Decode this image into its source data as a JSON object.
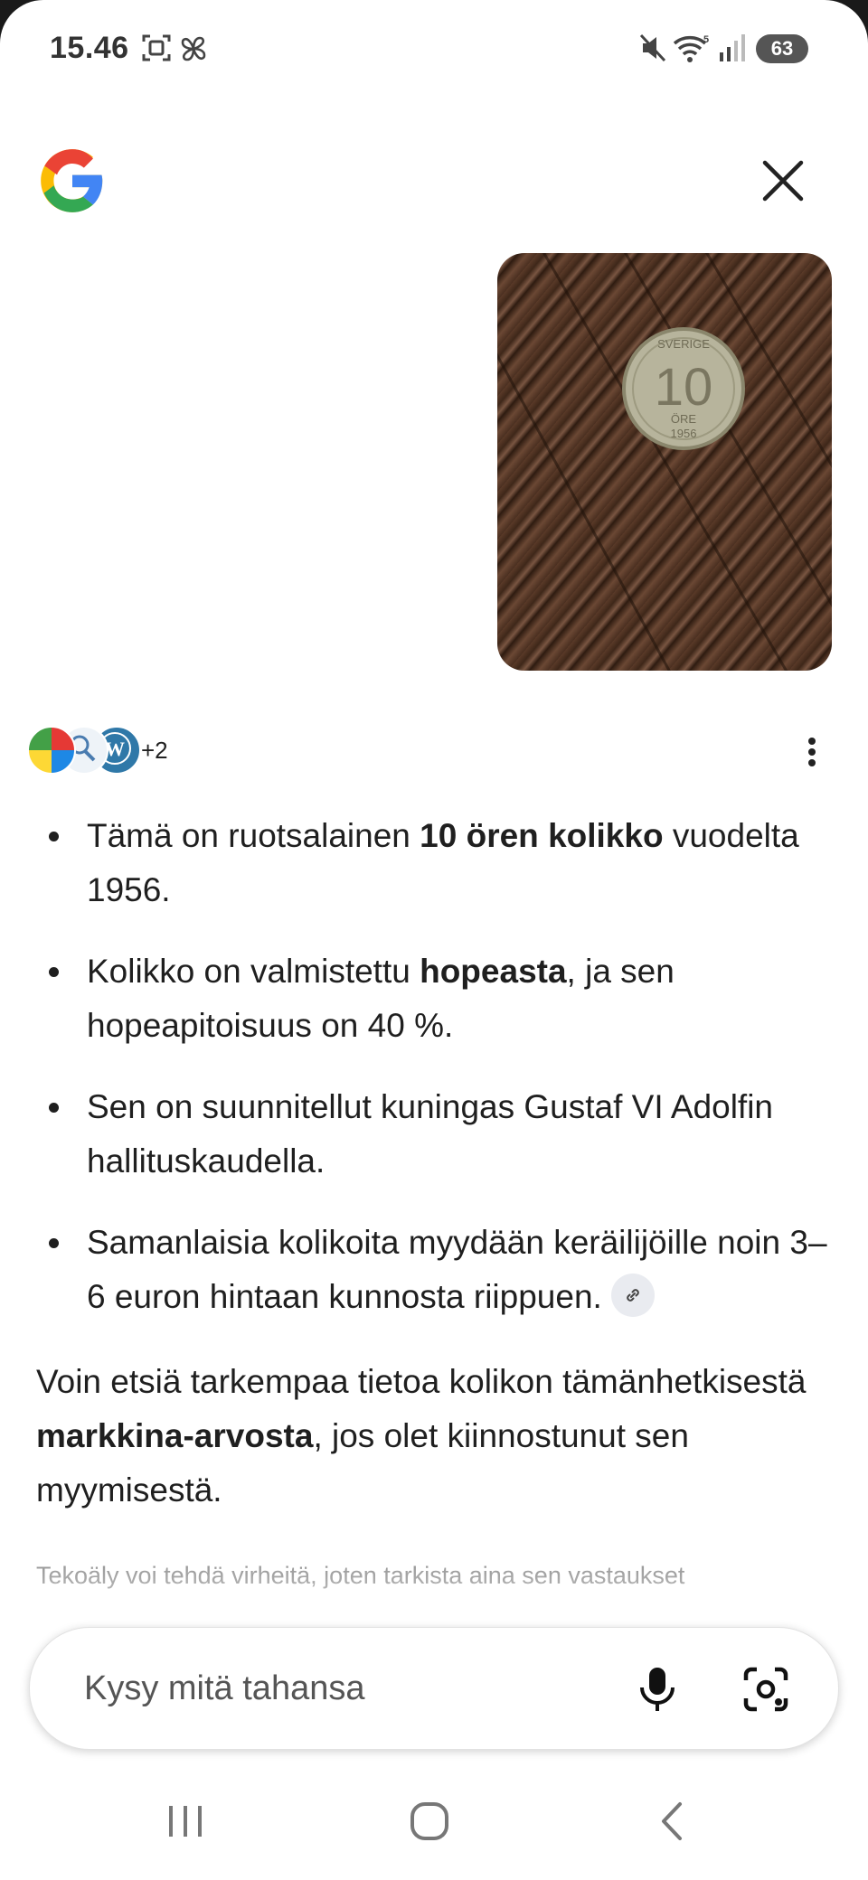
{
  "status_bar": {
    "time": "15.46",
    "battery": "63",
    "icons": [
      "screenshot-icon",
      "pinwheel-icon",
      "mute-icon",
      "wifi-icon",
      "signal-icon",
      "battery-icon"
    ]
  },
  "header": {
    "logo": "google-g-logo",
    "close_icon": "close-icon"
  },
  "photo": {
    "coin_top": "SVERIGE",
    "coin_value": "10",
    "coin_unit": "ÖRE",
    "coin_year": "1956"
  },
  "sources": {
    "more_label": "+2"
  },
  "answer": {
    "bullets": [
      {
        "pre": "Tämä on ruotsalainen ",
        "bold": "10 ören kolikko",
        "post": " vuodelta 1956."
      },
      {
        "pre": "Kolikko on valmistettu ",
        "bold": "hopeasta",
        "post": ", ja sen hopeapitoisuus on 40 %."
      },
      {
        "text": "Sen on suunnitellut kuningas Gustaf VI Adolfin hallituskaudella."
      },
      {
        "text": "Samanlaisia kolikoita myydään keräilijöille noin 3–6 euron hintaan kunnosta riippuen."
      }
    ],
    "paragraph": {
      "pre": "Voin etsiä tarkempaa tietoa kolikon tämänhetkisestä ",
      "bold": "markkina-arvosta",
      "post": ", jos olet kiinnostunut sen myymisestä."
    },
    "disclaimer": "Tekoäly voi tehdä virheitä, joten tarkista aina sen vastaukset"
  },
  "input": {
    "placeholder": "Kysy mitä tahansa"
  },
  "colors": {
    "google_blue": "#4285F4",
    "google_red": "#EA4335",
    "google_yellow": "#FBBC05",
    "google_green": "#34A853",
    "chip_bg": "#e9ebf0"
  }
}
